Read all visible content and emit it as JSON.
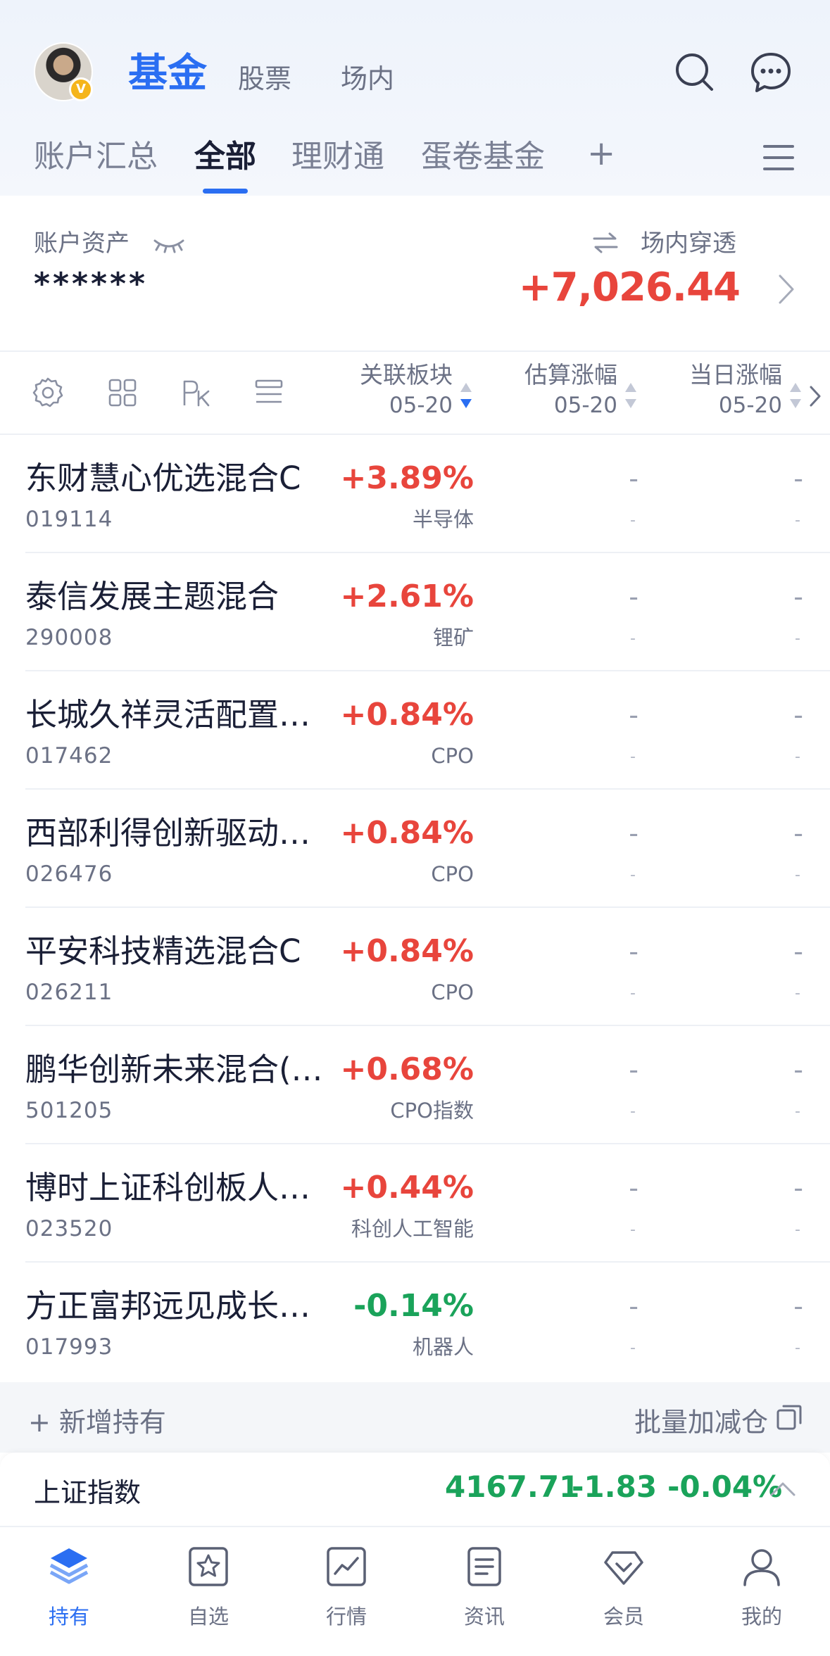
{
  "header": {
    "avatar_badge": "V",
    "tabs": [
      {
        "label": "基金",
        "active": true
      },
      {
        "label": "股票",
        "active": false
      },
      {
        "label": "场内",
        "active": false
      }
    ],
    "search_icon": "search-icon",
    "message_icon": "message-icon"
  },
  "account_tabs": [
    {
      "label": "账户汇总",
      "active": false
    },
    {
      "label": "全部",
      "active": true
    },
    {
      "label": "理财通",
      "active": false
    },
    {
      "label": "蛋卷基金",
      "active": false
    },
    {
      "label": "+",
      "active": false
    }
  ],
  "assets": {
    "label": "账户资产",
    "hidden_value": "******",
    "penetrate_label": "场内穿透",
    "profit": "+7,026.44"
  },
  "table_header": {
    "columns": [
      {
        "title": "关联板块",
        "date": "05-20"
      },
      {
        "title": "估算涨幅",
        "date": "05-20"
      },
      {
        "title": "当日涨幅",
        "date": "05-20"
      }
    ]
  },
  "funds": [
    {
      "name": "东财慧心优选混合C",
      "code": "019114",
      "change": "+3.89%",
      "sector": "半导体",
      "trend": "up",
      "est": "-",
      "est_sub": "-",
      "day": "-",
      "day_sub": "-"
    },
    {
      "name": "泰信发展主题混合",
      "code": "290008",
      "change": "+2.61%",
      "sector": "锂矿",
      "trend": "up",
      "est": "-",
      "est_sub": "-",
      "day": "-",
      "day_sub": "-"
    },
    {
      "name": "长城久祥灵活配置…",
      "code": "017462",
      "change": "+0.84%",
      "sector": "CPO",
      "trend": "up",
      "est": "-",
      "est_sub": "-",
      "day": "-",
      "day_sub": "-"
    },
    {
      "name": "西部利得创新驱动…",
      "code": "026476",
      "change": "+0.84%",
      "sector": "CPO",
      "trend": "up",
      "est": "-",
      "est_sub": "-",
      "day": "-",
      "day_sub": "-"
    },
    {
      "name": "平安科技精选混合C",
      "code": "026211",
      "change": "+0.84%",
      "sector": "CPO",
      "trend": "up",
      "est": "-",
      "est_sub": "-",
      "day": "-",
      "day_sub": "-"
    },
    {
      "name": "鹏华创新未来混合(…",
      "code": "501205",
      "change": "+0.68%",
      "sector": "CPO指数",
      "trend": "up",
      "est": "-",
      "est_sub": "-",
      "day": "-",
      "day_sub": "-"
    },
    {
      "name": "博时上证科创板人…",
      "code": "023520",
      "change": "+0.44%",
      "sector": "科创人工智能",
      "trend": "up",
      "est": "-",
      "est_sub": "-",
      "day": "-",
      "day_sub": "-"
    },
    {
      "name": "方正富邦远见成长…",
      "code": "017993",
      "change": "-0.14%",
      "sector": "机器人",
      "trend": "down",
      "est": "-",
      "est_sub": "-",
      "day": "-",
      "day_sub": "-"
    }
  ],
  "actions": {
    "add_holding": "+ 新增持有",
    "batch_adjust": "批量加减仓"
  },
  "index_bar": {
    "name": "上证指数",
    "value": "4167.71",
    "change": "-1.83",
    "percent": "-0.04%"
  },
  "bottom_nav": [
    {
      "label": "持有",
      "icon": "layers-icon",
      "active": true
    },
    {
      "label": "自选",
      "icon": "star-icon",
      "active": false
    },
    {
      "label": "行情",
      "icon": "chart-icon",
      "active": false
    },
    {
      "label": "资讯",
      "icon": "news-icon",
      "active": false
    },
    {
      "label": "会员",
      "icon": "diamond-icon",
      "active": false
    },
    {
      "label": "我的",
      "icon": "user-icon",
      "active": false
    }
  ],
  "colors": {
    "accent": "#2a6ef2",
    "up": "#e8453c",
    "down": "#1aa35a",
    "text_secondary": "#6b7185"
  }
}
